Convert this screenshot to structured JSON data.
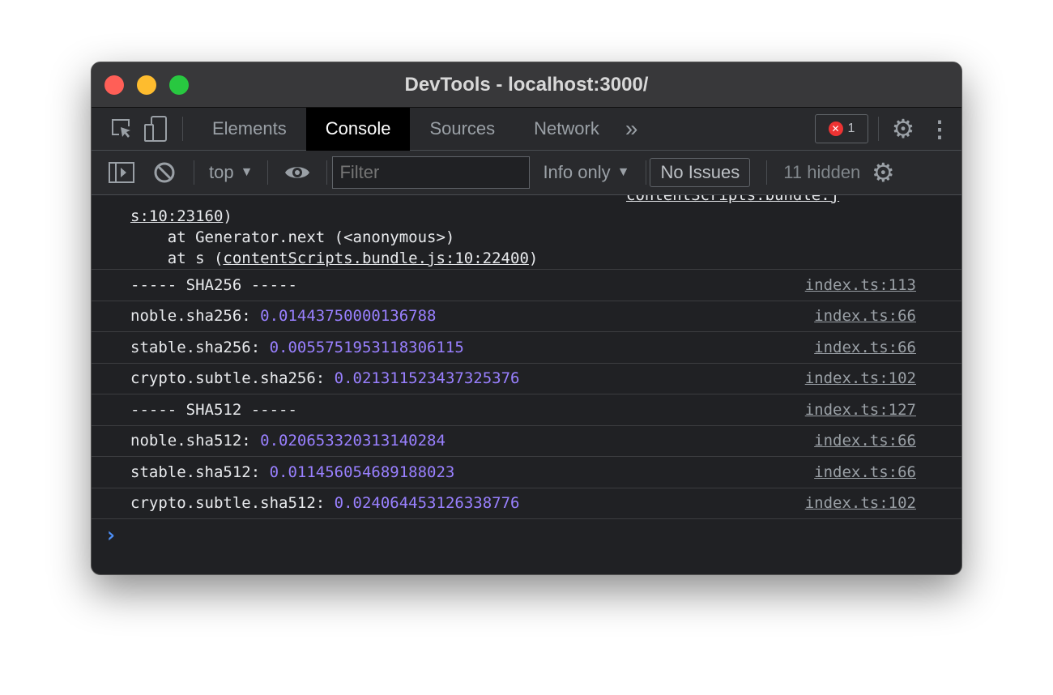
{
  "window": {
    "title": "DevTools - localhost:3000/",
    "lights": [
      "#ff5f57",
      "#febc2e",
      "#28c840"
    ]
  },
  "tabs": [
    {
      "label": "Elements"
    },
    {
      "label": "Console",
      "active": true
    },
    {
      "label": "Sources"
    },
    {
      "label": "Network"
    }
  ],
  "more_tabs": "»",
  "error_count": "1",
  "toolbar": {
    "context": "top",
    "filter_placeholder": "Filter",
    "level": "Info only",
    "issues": "No Issues",
    "hidden": "11 hidden"
  },
  "trace": {
    "line0_link": "contentScripts.bundle.j",
    "line1_link": "s:10:23160",
    "line1_tail": ")",
    "line2": "    at Generator.next (<anonymous>)",
    "line3_pre": "    at s (",
    "line3_link": "contentScripts.bundle.js:10:22400",
    "line3_post": ")"
  },
  "logs": [
    {
      "label": "----- SHA256 -----",
      "value": "",
      "source": "index.ts:113"
    },
    {
      "label": "noble.sha256: ",
      "value": "0.01443750000136788",
      "source": "index.ts:66"
    },
    {
      "label": "stable.sha256: ",
      "value": "0.0055751953118306115",
      "source": "index.ts:66"
    },
    {
      "label": "crypto.subtle.sha256: ",
      "value": "0.021311523437325376",
      "source": "index.ts:102"
    },
    {
      "label": "----- SHA512 -----",
      "value": "",
      "source": "index.ts:127"
    },
    {
      "label": "noble.sha512: ",
      "value": "0.020653320313140284",
      "source": "index.ts:66"
    },
    {
      "label": "stable.sha512: ",
      "value": "0.011456054689188023",
      "source": "index.ts:66"
    },
    {
      "label": "crypto.subtle.sha512: ",
      "value": "0.024064453126338776",
      "source": "index.ts:102"
    }
  ],
  "prompt": "›"
}
